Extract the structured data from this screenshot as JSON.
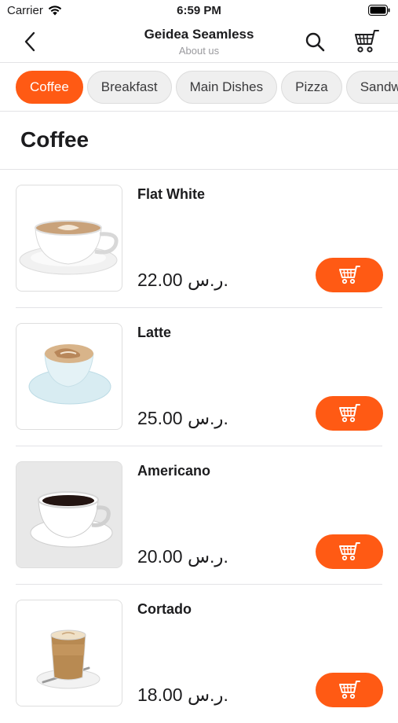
{
  "status_bar": {
    "carrier": "Carrier",
    "time": "6:59 PM"
  },
  "nav": {
    "title": "Geidea Seamless",
    "subtitle": "About us"
  },
  "categories": [
    "Coffee",
    "Breakfast",
    "Main Dishes",
    "Pizza",
    "Sandwiches"
  ],
  "active_category": "Coffee",
  "section": {
    "title": "Coffee"
  },
  "items": [
    {
      "name": "Flat White",
      "price": "22.00 ر.س."
    },
    {
      "name": "Latte",
      "price": "25.00 ر.س."
    },
    {
      "name": "Americano",
      "price": "20.00 ر.س."
    },
    {
      "name": "Cortado",
      "price": "18.00 ر.س."
    }
  ],
  "colors": {
    "accent": "#ff5a14",
    "chip_bg": "#efefef",
    "divider": "#e3e3e6"
  },
  "icons": {
    "back": "chevron-left-icon",
    "search": "search-icon",
    "cart": "shopping-cart-icon",
    "add_to_cart": "cart-icon"
  }
}
